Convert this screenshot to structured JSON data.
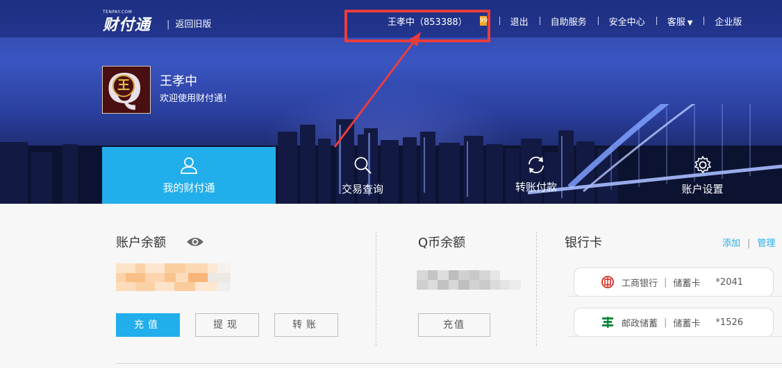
{
  "header": {
    "logo_text": "财付通",
    "logo_small": "TENPAY.COM",
    "back_old": "返回旧版",
    "user_id": "王孝中（853388）",
    "msg_badge": "99",
    "nav": [
      "退出",
      "自助服务",
      "安全中心",
      "客服",
      "企业版"
    ]
  },
  "profile": {
    "name": "王孝中",
    "welcome": "欢迎使用财付通！",
    "avatar_letter": "Q",
    "avatar_char": "王"
  },
  "tabs": [
    {
      "label": "我的财付通",
      "icon": "user-icon",
      "active": true
    },
    {
      "label": "交易查询",
      "icon": "search-icon",
      "active": false
    },
    {
      "label": "转账付款",
      "icon": "refresh-icon",
      "active": false
    },
    {
      "label": "账户设置",
      "icon": "gear-icon",
      "active": false
    }
  ],
  "account": {
    "balance_title": "账户余额",
    "buttons": [
      "充值",
      "提现",
      "转账"
    ]
  },
  "qcoin": {
    "title": "Q币余额",
    "button": "充值"
  },
  "bank": {
    "title": "银行卡",
    "add": "添加",
    "manage": "管理",
    "cards": [
      {
        "bank": "工商银行",
        "type": "储蓄卡",
        "number": "*2041",
        "icon": "icbc-logo-icon",
        "color": "#d6281e"
      },
      {
        "bank": "邮政储蓄",
        "type": "储蓄卡",
        "number": "*1526",
        "icon": "psbc-logo-icon",
        "color": "#0e8a3c"
      }
    ]
  },
  "colors": {
    "accent": "#22aeeb",
    "highlight": "#ea3d3d"
  }
}
